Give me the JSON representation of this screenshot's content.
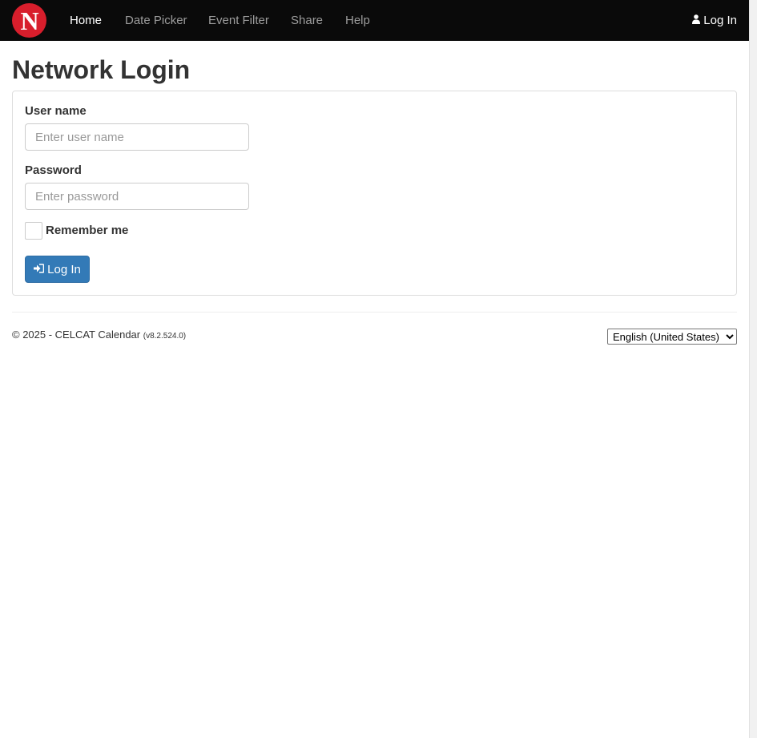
{
  "colors": {
    "navbar_bg": "#0a0a0a",
    "logo_red": "#d81e2c",
    "primary_button": "#337ab7"
  },
  "navbar": {
    "logo_icon": "university-logo-icon",
    "items": [
      {
        "label": "Home",
        "active": true
      },
      {
        "label": "Date Picker",
        "active": false
      },
      {
        "label": "Event Filter",
        "active": false
      },
      {
        "label": "Share",
        "active": false
      },
      {
        "label": "Help",
        "active": false
      }
    ],
    "login": {
      "label": "Log In",
      "icon": "user-icon"
    }
  },
  "main": {
    "title": "Network Login",
    "form": {
      "username_label": "User name",
      "username_placeholder": "Enter user name",
      "username_value": "",
      "password_label": "Password",
      "password_placeholder": "Enter password",
      "password_value": "",
      "remember_label": "Remember me",
      "remember_checked": false,
      "submit_label": "Log In",
      "submit_icon": "sign-in-icon"
    }
  },
  "footer": {
    "copyright": "© 2025 - CELCAT Calendar",
    "version": "(v8.2.524.0)",
    "language": "English (United States)"
  }
}
